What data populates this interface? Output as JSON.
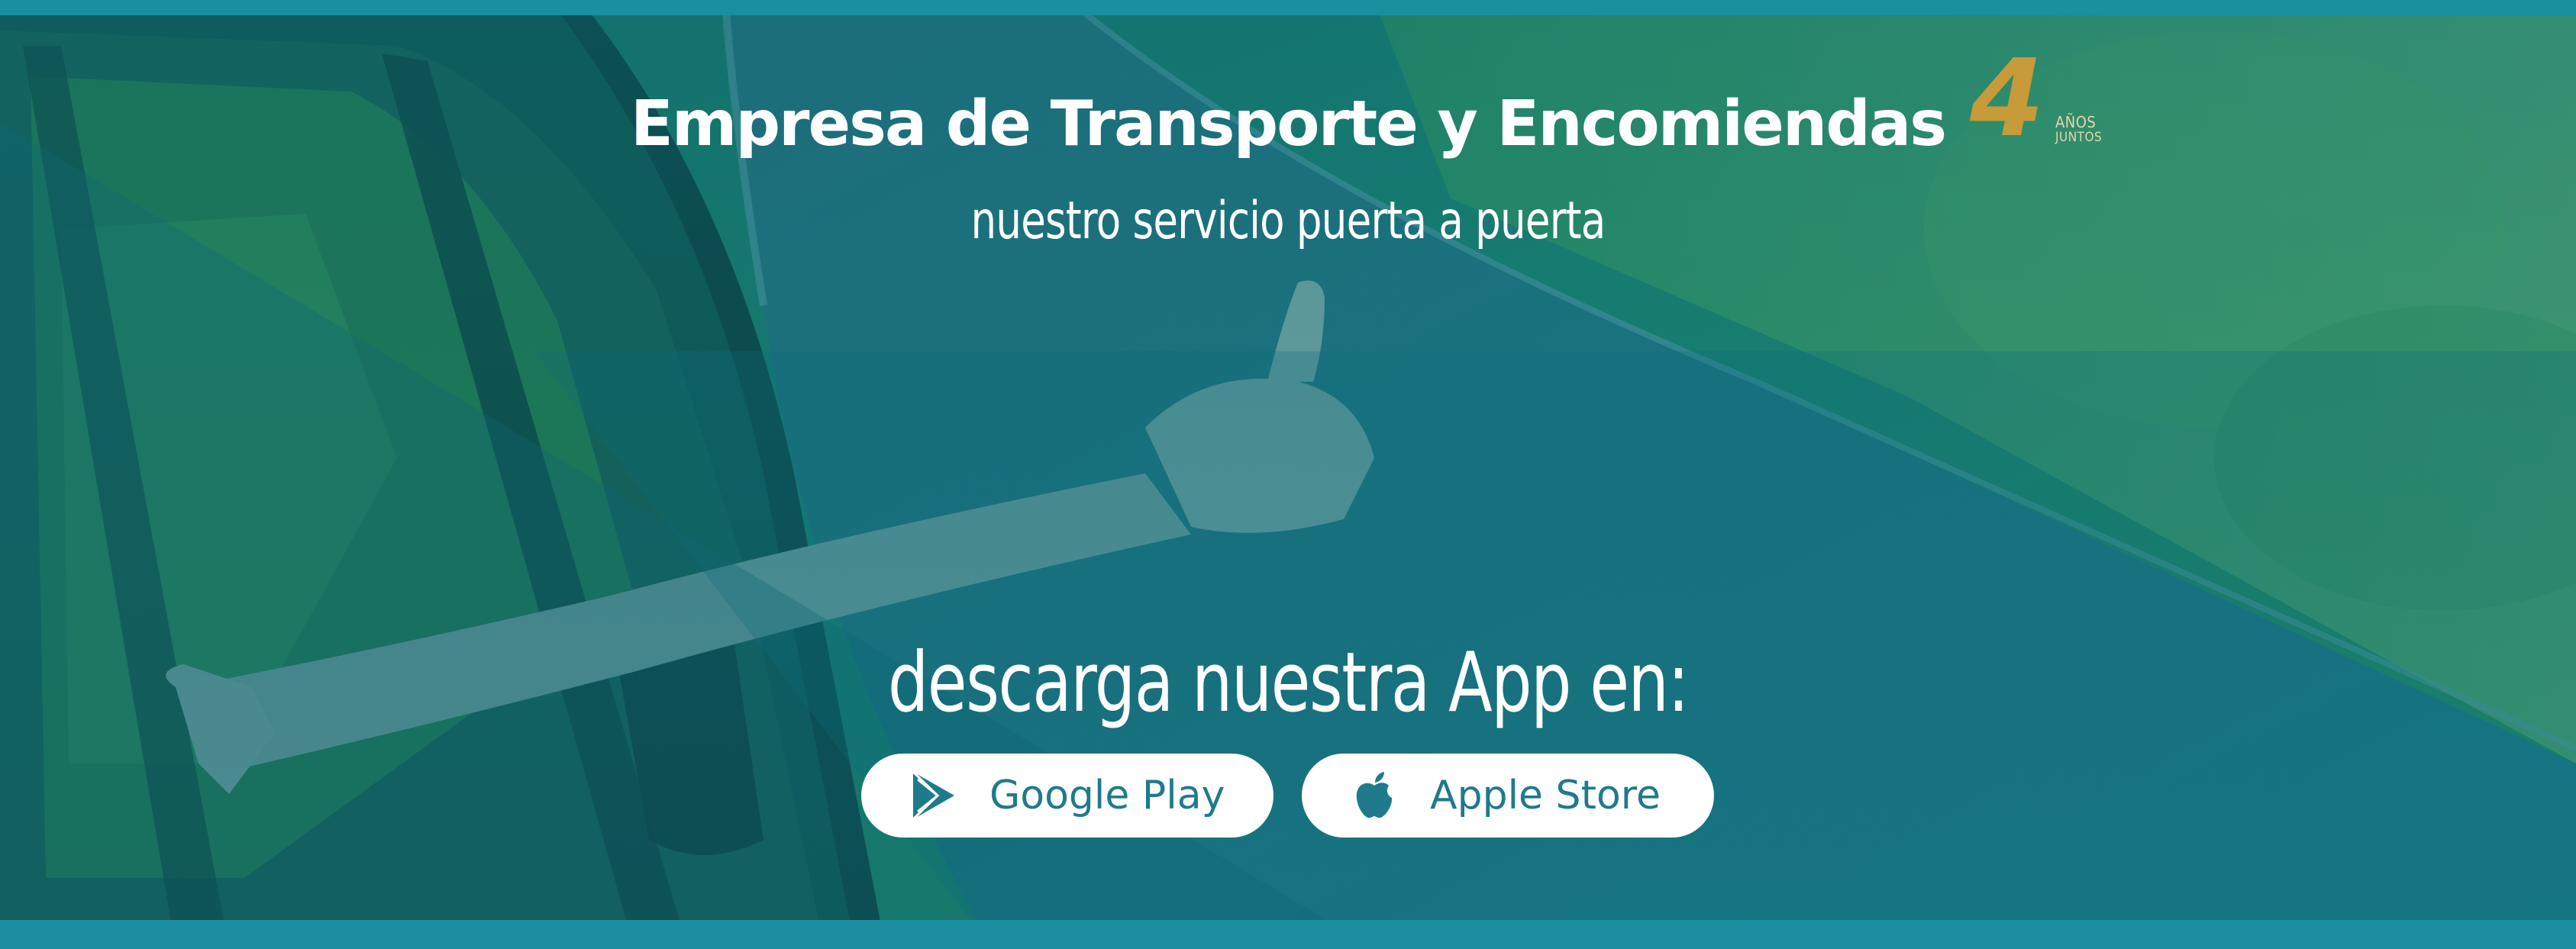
{
  "banner": {
    "headline": "Empresa de Transporte y Encomiendas",
    "tagline": "nuestro servicio puerta a puerta",
    "anniversary": {
      "number": "4",
      "line1": "AÑOS",
      "line2": "JUNTOS"
    },
    "download_text": "descarga nuestra App en:",
    "stores": [
      {
        "label": "Google Play",
        "icon": "google-play-icon"
      },
      {
        "label": "Apple Store",
        "icon": "apple-icon"
      }
    ],
    "colors": {
      "accent": "#1b8fa0",
      "button_text": "#1f7a8c",
      "anniversary_gold": "#c79a3a"
    }
  }
}
